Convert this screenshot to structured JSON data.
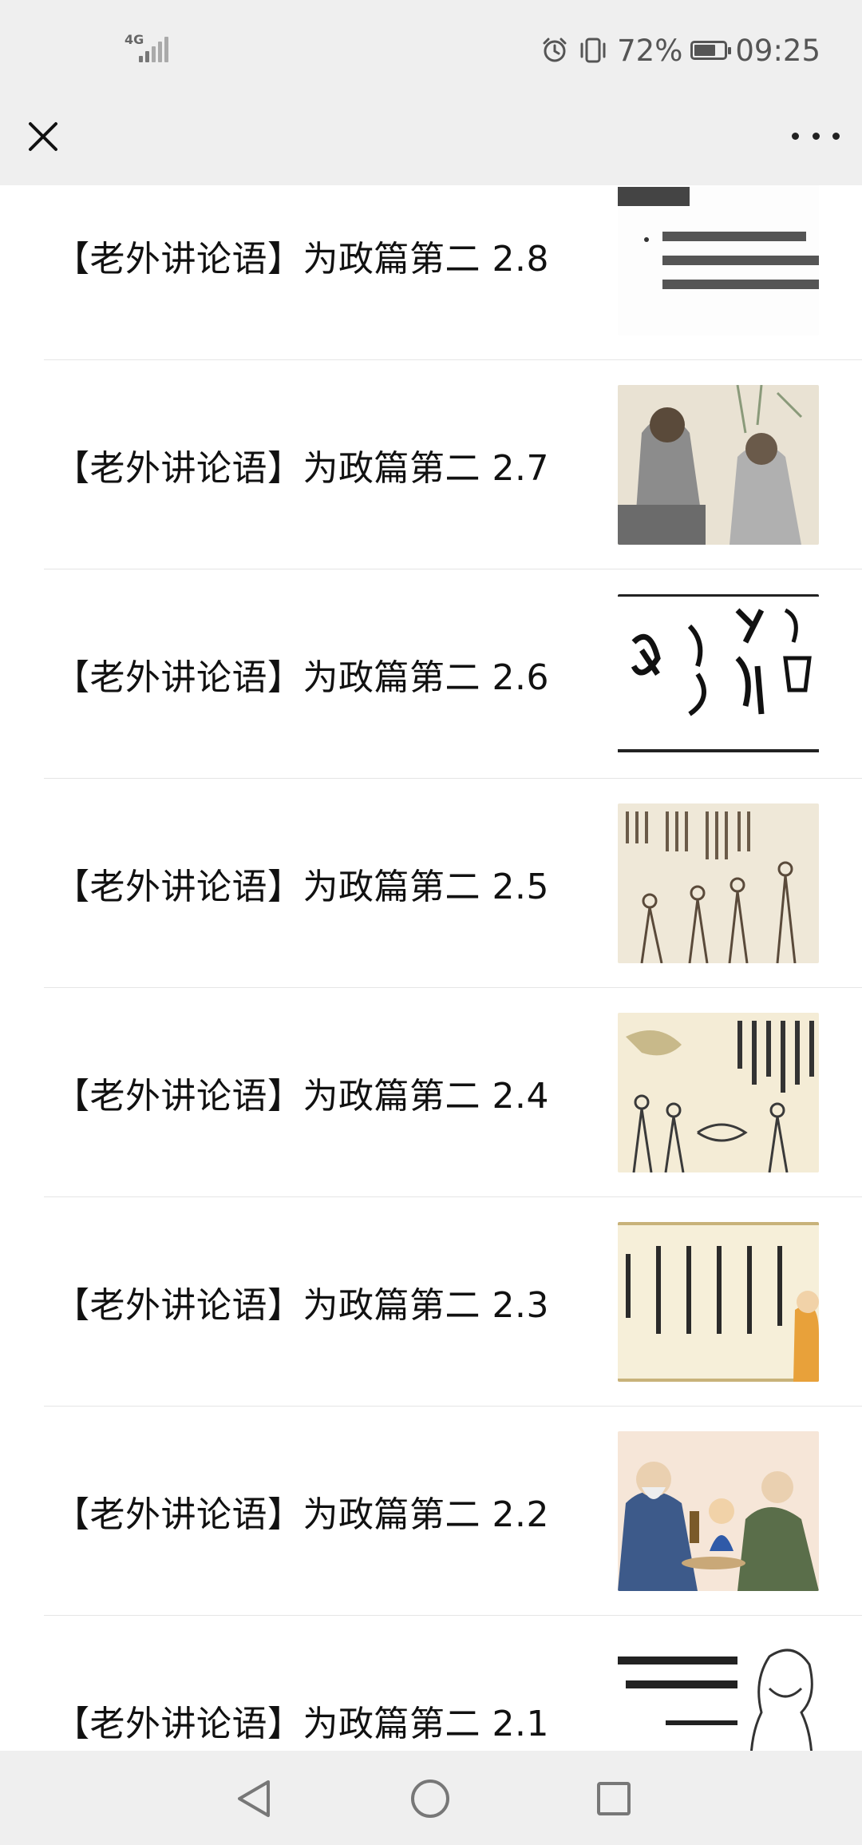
{
  "status_bar": {
    "network": "4G",
    "battery": "72%",
    "battery_level": 0.72,
    "time": "09:25"
  },
  "header": {
    "close_icon": "close-icon",
    "more_icon": "more-icon"
  },
  "articles": [
    {
      "title": "【老外讲论语】为政篇第二 2.8"
    },
    {
      "title": "【老外讲论语】为政篇第二 2.7"
    },
    {
      "title": "【老外讲论语】为政篇第二 2.6"
    },
    {
      "title": "【老外讲论语】为政篇第二 2.5"
    },
    {
      "title": "【老外讲论语】为政篇第二 2.4"
    },
    {
      "title": "【老外讲论语】为政篇第二 2.3"
    },
    {
      "title": "【老外讲论语】为政篇第二 2.2"
    },
    {
      "title": "【老外讲论语】为政篇第二 2.1"
    }
  ],
  "nav_bar": {
    "back_icon": "back-icon",
    "home_icon": "home-icon",
    "recent_apps_icon": "recent-apps-icon"
  },
  "colors": {
    "bar_bg": "#efefef",
    "separator": "#e5e5e5",
    "text": "#111111"
  }
}
